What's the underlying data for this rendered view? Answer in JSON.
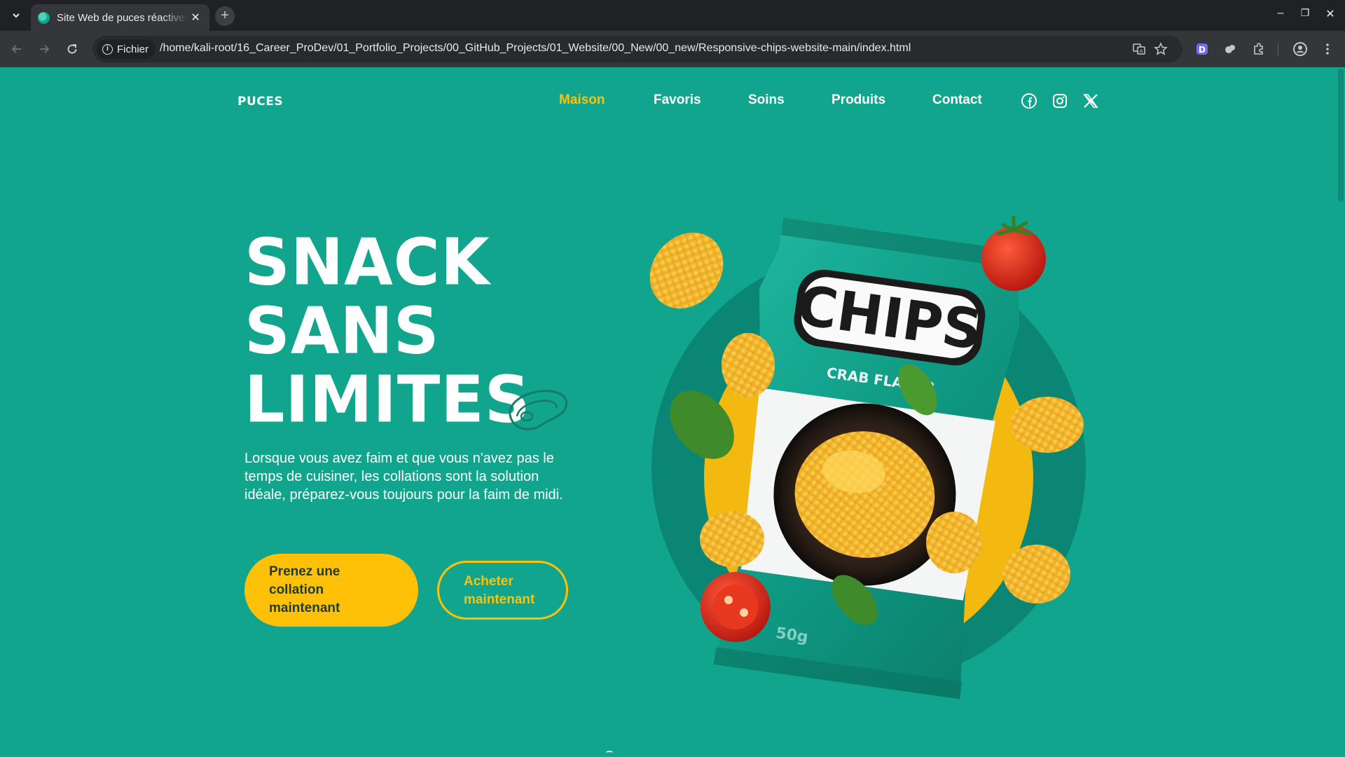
{
  "browser": {
    "tab_title": "Site Web de puces réactives",
    "tab_close": "✕",
    "new_tab": "+",
    "site_chip": "Fichier",
    "url": "/home/kali-root/16_Career_ProDev/01_Portfolio_Projects/00_GitHub_Projects/01_Website/00_New/00_new/Responsive-chips-website-main/index.html",
    "controls": {
      "minimize": "–",
      "restore": "❐",
      "close": "✕"
    }
  },
  "site": {
    "logo": "PUCES",
    "nav": [
      {
        "label": "Maison",
        "active": true
      },
      {
        "label": "Favoris"
      },
      {
        "label": "Soins"
      },
      {
        "label": "Produits"
      },
      {
        "label": "Contact"
      }
    ],
    "social_icons": [
      "facebook-icon",
      "instagram-icon",
      "x-icon"
    ],
    "accent_color": "#ffc107",
    "background_color": "#11a58d"
  },
  "hero": {
    "title_lines": [
      "SNACK",
      "SANS",
      "LIMITES"
    ],
    "description": "Lorsque vous avez faim et que vous n'avez pas le temps de cuisiner, les collations sont la solution idéale, préparez-vous toujours pour la faim de midi.",
    "primary_button": "Prenez une collation maintenant",
    "secondary_button": "Acheter maintenant"
  },
  "product": {
    "brand": "CHIPS",
    "flavor": "CRAB FLAVOR",
    "weight": "50g"
  }
}
